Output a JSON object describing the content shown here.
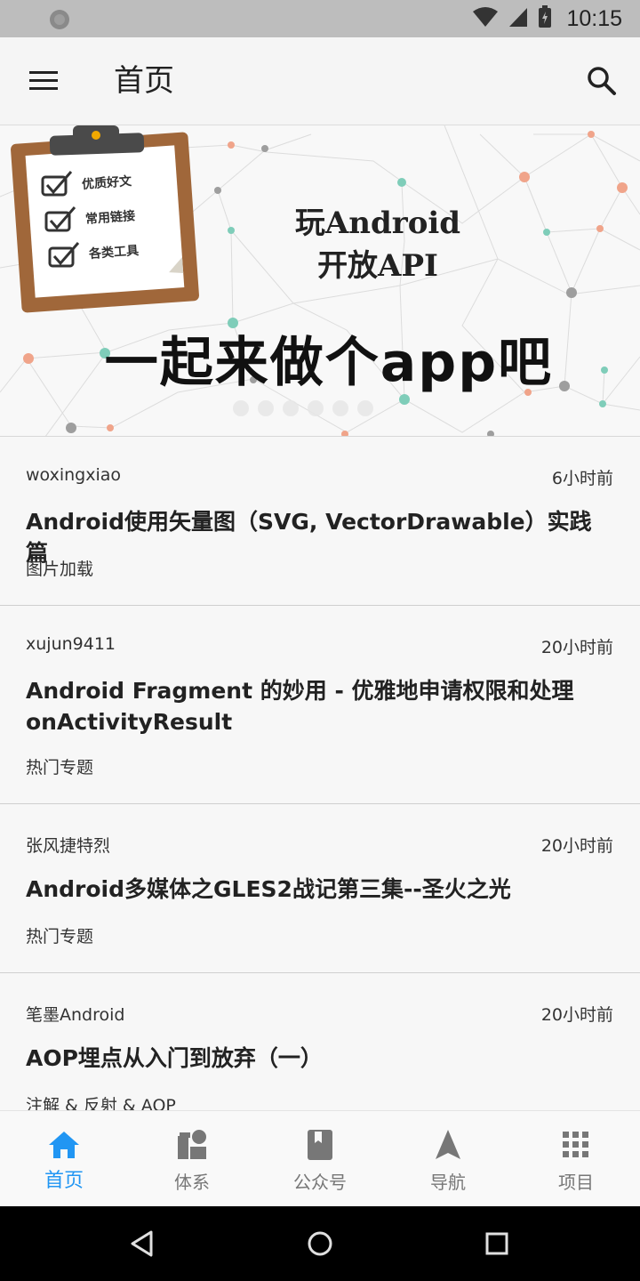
{
  "status_bar": {
    "time": "10:15"
  },
  "app_bar": {
    "title": "首页"
  },
  "banner": {
    "title_line1": "玩Android",
    "title_line2": "开放API",
    "slogan": "一起来做个app吧",
    "clipboard_items": [
      "优质好文",
      "常用链接",
      "各类工具"
    ],
    "slide_count": 6
  },
  "articles": [
    {
      "author": "woxingxiao",
      "time": "6小时前",
      "title": "Android使用矢量图（SVG, VectorDrawable）实践篇",
      "tag": "图片加载"
    },
    {
      "author": "xujun9411",
      "time": "20小时前",
      "title": "Android Fragment 的妙用 - 优雅地申请权限和处理onActivityResult",
      "tag": "热门专题"
    },
    {
      "author": "张风捷特烈",
      "time": "20小时前",
      "title": "Android多媒体之GLES2战记第三集--圣火之光",
      "tag": "热门专题"
    },
    {
      "author": "笔墨Android",
      "time": "20小时前",
      "title": "AOP埋点从入门到放弃（一）",
      "tag": "注解 & 反射 & AOP"
    }
  ],
  "bottom_nav": {
    "items": [
      {
        "label": "首页",
        "icon": "home-icon",
        "active": true
      },
      {
        "label": "体系",
        "icon": "category-icon",
        "active": false
      },
      {
        "label": "公众号",
        "icon": "book-icon",
        "active": false
      },
      {
        "label": "导航",
        "icon": "navigation-icon",
        "active": false
      },
      {
        "label": "项目",
        "icon": "apps-grid-icon",
        "active": false
      }
    ]
  },
  "colors": {
    "accent": "#2196f3",
    "inactive": "#777777",
    "status_bar": "#bdbdbd"
  }
}
